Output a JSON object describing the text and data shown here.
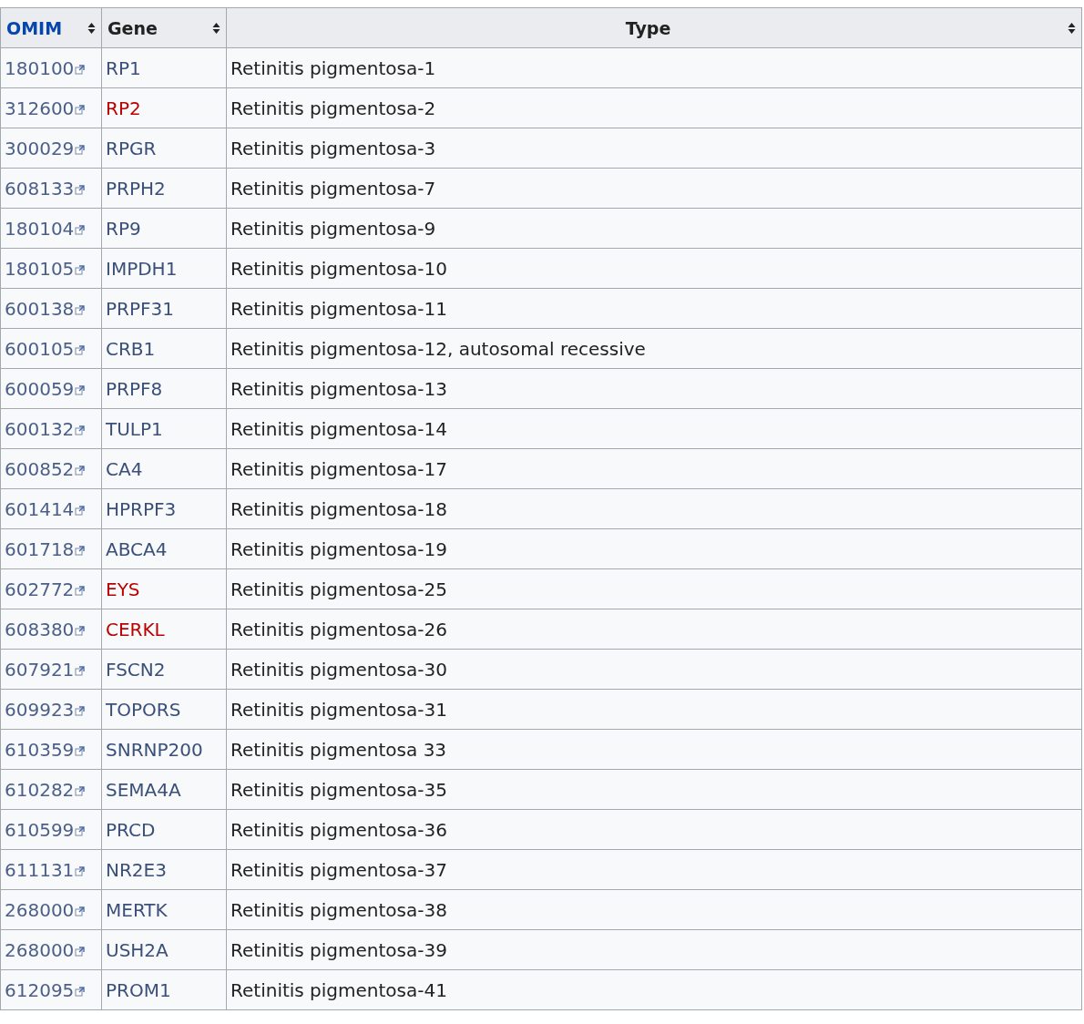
{
  "table": {
    "columns": [
      {
        "label": "OMIM"
      },
      {
        "label": "Gene"
      },
      {
        "label": "Type"
      }
    ],
    "rows": [
      {
        "omim": "180100",
        "gene": "RP1",
        "gene_missing": false,
        "type": "Retinitis pigmentosa-1"
      },
      {
        "omim": "312600",
        "gene": "RP2",
        "gene_missing": true,
        "type": "Retinitis pigmentosa-2"
      },
      {
        "omim": "300029",
        "gene": "RPGR",
        "gene_missing": false,
        "type": "Retinitis pigmentosa-3"
      },
      {
        "omim": "608133",
        "gene": "PRPH2",
        "gene_missing": false,
        "type": "Retinitis pigmentosa-7"
      },
      {
        "omim": "180104",
        "gene": "RP9",
        "gene_missing": false,
        "type": "Retinitis pigmentosa-9"
      },
      {
        "omim": "180105",
        "gene": "IMPDH1",
        "gene_missing": false,
        "type": "Retinitis pigmentosa-10"
      },
      {
        "omim": "600138",
        "gene": "PRPF31",
        "gene_missing": false,
        "type": "Retinitis pigmentosa-11"
      },
      {
        "omim": "600105",
        "gene": "CRB1",
        "gene_missing": false,
        "type": "Retinitis pigmentosa-12, autosomal recessive"
      },
      {
        "omim": "600059",
        "gene": "PRPF8",
        "gene_missing": false,
        "type": "Retinitis pigmentosa-13"
      },
      {
        "omim": "600132",
        "gene": "TULP1",
        "gene_missing": false,
        "type": "Retinitis pigmentosa-14"
      },
      {
        "omim": "600852",
        "gene": "CA4",
        "gene_missing": false,
        "type": "Retinitis pigmentosa-17"
      },
      {
        "omim": "601414",
        "gene": "HPRPF3",
        "gene_missing": false,
        "type": "Retinitis pigmentosa-18"
      },
      {
        "omim": "601718",
        "gene": "ABCA4",
        "gene_missing": false,
        "type": "Retinitis pigmentosa-19"
      },
      {
        "omim": "602772",
        "gene": "EYS",
        "gene_missing": true,
        "type": "Retinitis pigmentosa-25"
      },
      {
        "omim": "608380",
        "gene": "CERKL",
        "gene_missing": true,
        "type": "Retinitis pigmentosa-26"
      },
      {
        "omim": "607921",
        "gene": "FSCN2",
        "gene_missing": false,
        "type": "Retinitis pigmentosa-30"
      },
      {
        "omim": "609923",
        "gene": "TOPORS",
        "gene_missing": false,
        "type": "Retinitis pigmentosa-31"
      },
      {
        "omim": "610359",
        "gene": "SNRNP200",
        "gene_missing": false,
        "type": "Retinitis pigmentosa 33"
      },
      {
        "omim": "610282",
        "gene": "SEMA4A",
        "gene_missing": false,
        "type": "Retinitis pigmentosa-35"
      },
      {
        "omim": "610599",
        "gene": "PRCD",
        "gene_missing": false,
        "type": "Retinitis pigmentosa-36"
      },
      {
        "omim": "611131",
        "gene": "NR2E3",
        "gene_missing": false,
        "type": "Retinitis pigmentosa-37"
      },
      {
        "omim": "268000",
        "gene": "MERTK",
        "gene_missing": false,
        "type": "Retinitis pigmentosa-38"
      },
      {
        "omim": "268000",
        "gene": "USH2A",
        "gene_missing": false,
        "type": "Retinitis pigmentosa-39"
      },
      {
        "omim": "612095",
        "gene": "PROM1",
        "gene_missing": false,
        "type": "Retinitis pigmentosa-41"
      }
    ]
  }
}
